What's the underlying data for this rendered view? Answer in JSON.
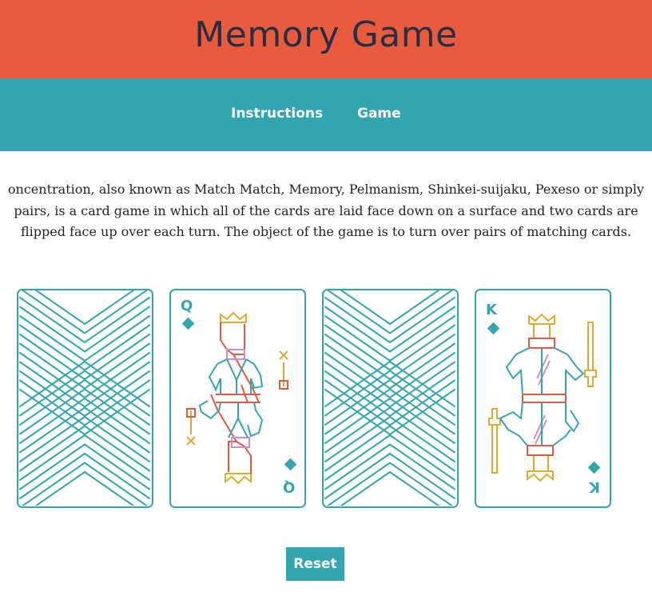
{
  "header": {
    "title": "Memory Game"
  },
  "nav": {
    "items": [
      "Instructions",
      "Game"
    ]
  },
  "description": {
    "lines": [
      "oncentration, also known as Match Match, Memory, Pelmanism, Shinkei-suijaku, Pexeso or simply",
      "pairs, is a card game in which all of the cards are laid face down on a surface and two cards are",
      "flipped face up over each turn. The object of the game is to turn over pairs of matching cards."
    ]
  },
  "cards": [
    {
      "state": "face-down"
    },
    {
      "state": "face-up",
      "rank": "Q",
      "suit": "diamond-icon"
    },
    {
      "state": "face-down"
    },
    {
      "state": "face-up",
      "rank": "K",
      "suit": "diamond-icon"
    }
  ],
  "controls": {
    "reset_label": "Reset"
  },
  "colors": {
    "header": "#e85c3d",
    "nav": "#33a5b1",
    "title": "#2a2e45",
    "card_accent": "#33a5b1",
    "figure_red": "#e05a3b",
    "figure_gold": "#e0a82e",
    "figure_pink": "#d48ac4"
  }
}
